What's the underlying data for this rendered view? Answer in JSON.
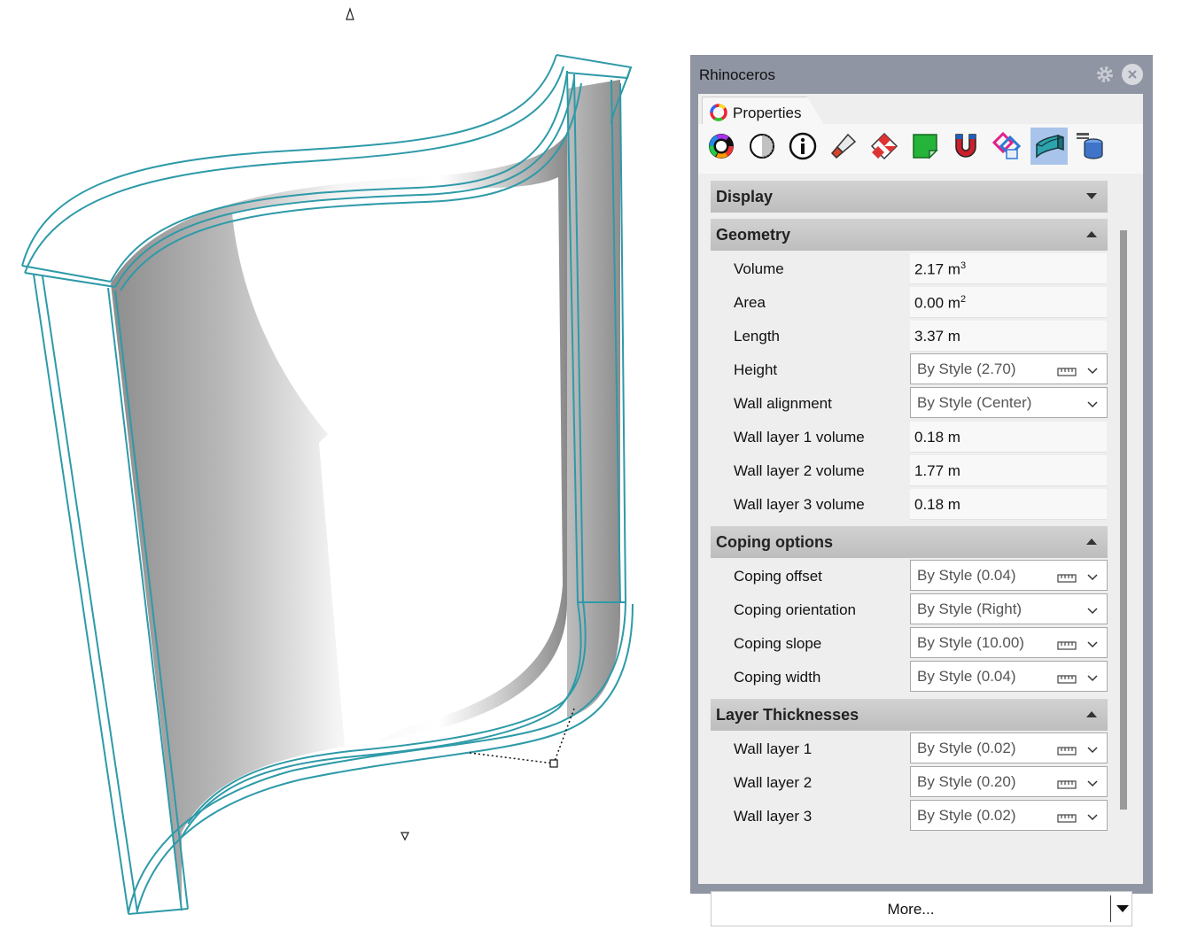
{
  "window": {
    "title": "Rhinoceros"
  },
  "tab": {
    "label": "Properties"
  },
  "icons": [
    {
      "name": "material-color-icon",
      "active": false
    },
    {
      "name": "object-display-icon",
      "active": false
    },
    {
      "name": "object-info-icon",
      "active": false
    },
    {
      "name": "paint-brush-icon",
      "active": false
    },
    {
      "name": "texture-mapping-icon",
      "active": false
    },
    {
      "name": "decal-icon",
      "active": false
    },
    {
      "name": "magnet-snap-icon",
      "active": false
    },
    {
      "name": "linked-block-icon",
      "active": false
    },
    {
      "name": "wall-object-icon",
      "active": true
    },
    {
      "name": "database-attributes-icon",
      "active": false
    }
  ],
  "sections": {
    "display": {
      "label": "Display",
      "collapsed": true
    },
    "geometry": {
      "label": "Geometry",
      "rows": [
        {
          "name": "Volume",
          "value": "2.17 m",
          "sup": "3"
        },
        {
          "name": "Area",
          "value": "0.00 m",
          "sup": "2"
        },
        {
          "name": "Length",
          "value": "3.37 m",
          "sup": ""
        },
        {
          "name": "Height",
          "control": "By Style (2.70)",
          "unit_icon": true
        },
        {
          "name": "Wall alignment",
          "control": "By Style (Center)",
          "unit_icon": false
        },
        {
          "name": "Wall layer 1 volume",
          "value": "0.18 m",
          "sup": ""
        },
        {
          "name": "Wall layer 2 volume",
          "value": "1.77 m",
          "sup": ""
        },
        {
          "name": "Wall layer 3 volume",
          "value": "0.18 m",
          "sup": ""
        }
      ]
    },
    "coping": {
      "label": "Coping options",
      "rows": [
        {
          "name": "Coping offset",
          "control": "By Style (0.04)",
          "unit_icon": true
        },
        {
          "name": "Coping orientation",
          "control": "By Style (Right)",
          "unit_icon": false
        },
        {
          "name": "Coping slope",
          "control": "By Style (10.00)",
          "unit_icon": true
        },
        {
          "name": "Coping width",
          "control": "By Style (0.04)",
          "unit_icon": true
        }
      ]
    },
    "layers": {
      "label": "Layer Thicknesses",
      "rows": [
        {
          "name": "Wall layer 1",
          "control": "By Style (0.02)",
          "unit_icon": true
        },
        {
          "name": "Wall layer 2",
          "control": "By Style (0.20)",
          "unit_icon": true
        },
        {
          "name": "Wall layer 3",
          "control": "By Style (0.02)",
          "unit_icon": true
        }
      ]
    }
  },
  "more": {
    "label": "More..."
  },
  "colors": {
    "wall_outline": "#2e9aa8",
    "panel_frame": "#8f95a3",
    "active_icon_bg": "#a9c4ea"
  }
}
